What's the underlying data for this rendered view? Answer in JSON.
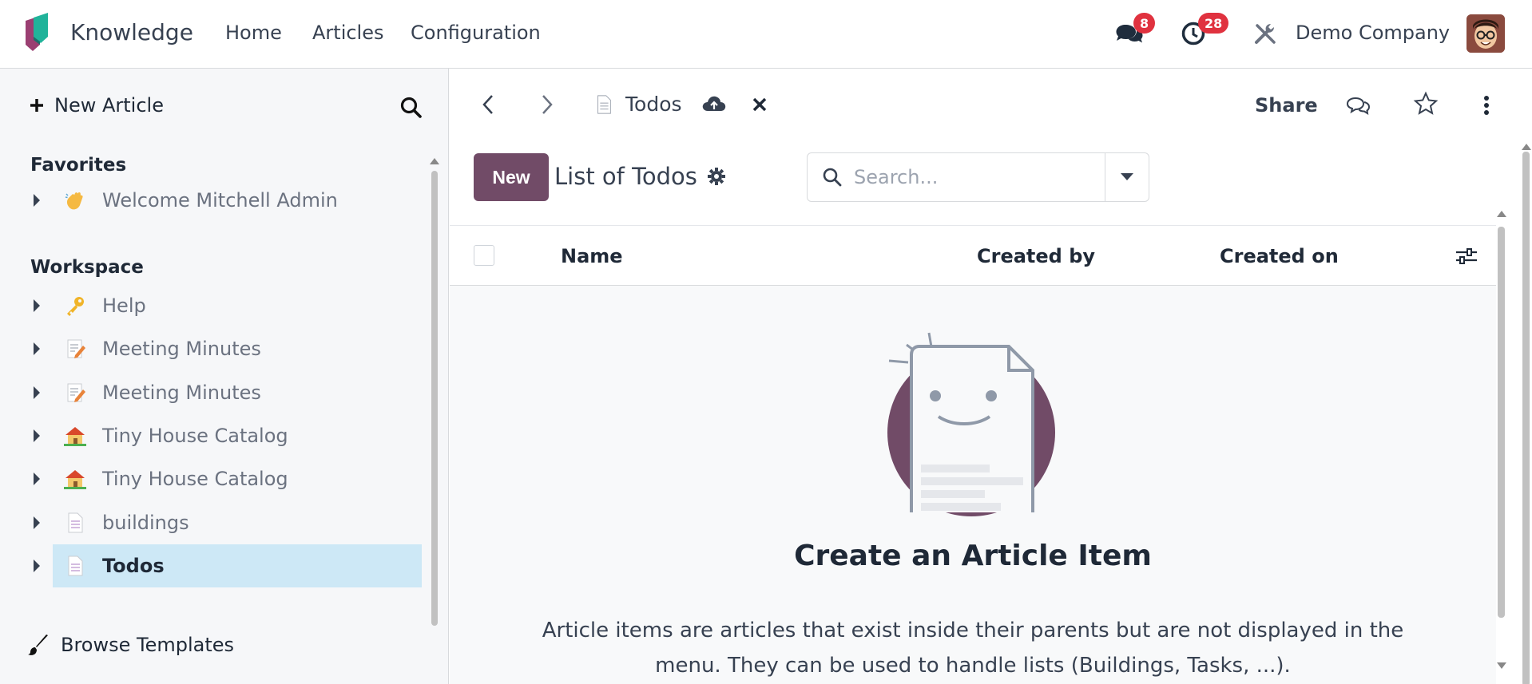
{
  "app": {
    "name": "Knowledge",
    "menu": [
      "Home",
      "Articles",
      "Configuration"
    ],
    "messages_count": "8",
    "activities_count": "28",
    "company": "Demo Company",
    "brand_color": "#714b67"
  },
  "sidebar": {
    "new_article_label": "New Article",
    "favorites_title": "Favorites",
    "favorites": [
      {
        "label": "Welcome Mitchell Admin",
        "icon": "waving-hand-icon"
      }
    ],
    "workspace_title": "Workspace",
    "workspace": [
      {
        "label": "Help",
        "icon": "key-icon"
      },
      {
        "label": "Meeting Minutes",
        "icon": "memo-icon"
      },
      {
        "label": "Meeting Minutes",
        "icon": "memo-icon"
      },
      {
        "label": "Tiny House Catalog",
        "icon": "house-icon"
      },
      {
        "label": "Tiny House Catalog",
        "icon": "house-icon"
      },
      {
        "label": "buildings",
        "icon": "page-icon"
      },
      {
        "label": "Todos",
        "icon": "page-icon",
        "active": true
      }
    ],
    "browse_templates_label": "Browse Templates"
  },
  "breadcrumb": {
    "title": "Todos",
    "share_label": "Share"
  },
  "control_panel": {
    "new_button": "New",
    "view_title": "List of Todos",
    "search_placeholder": "Search..."
  },
  "list": {
    "columns": [
      "Name",
      "Created by",
      "Created on"
    ]
  },
  "empty_state": {
    "title": "Create an Article Item",
    "text": "Article items are articles that exist inside their parents but are not displayed in the menu. They can be used to handle lists (Buildings, Tasks, ...)."
  }
}
